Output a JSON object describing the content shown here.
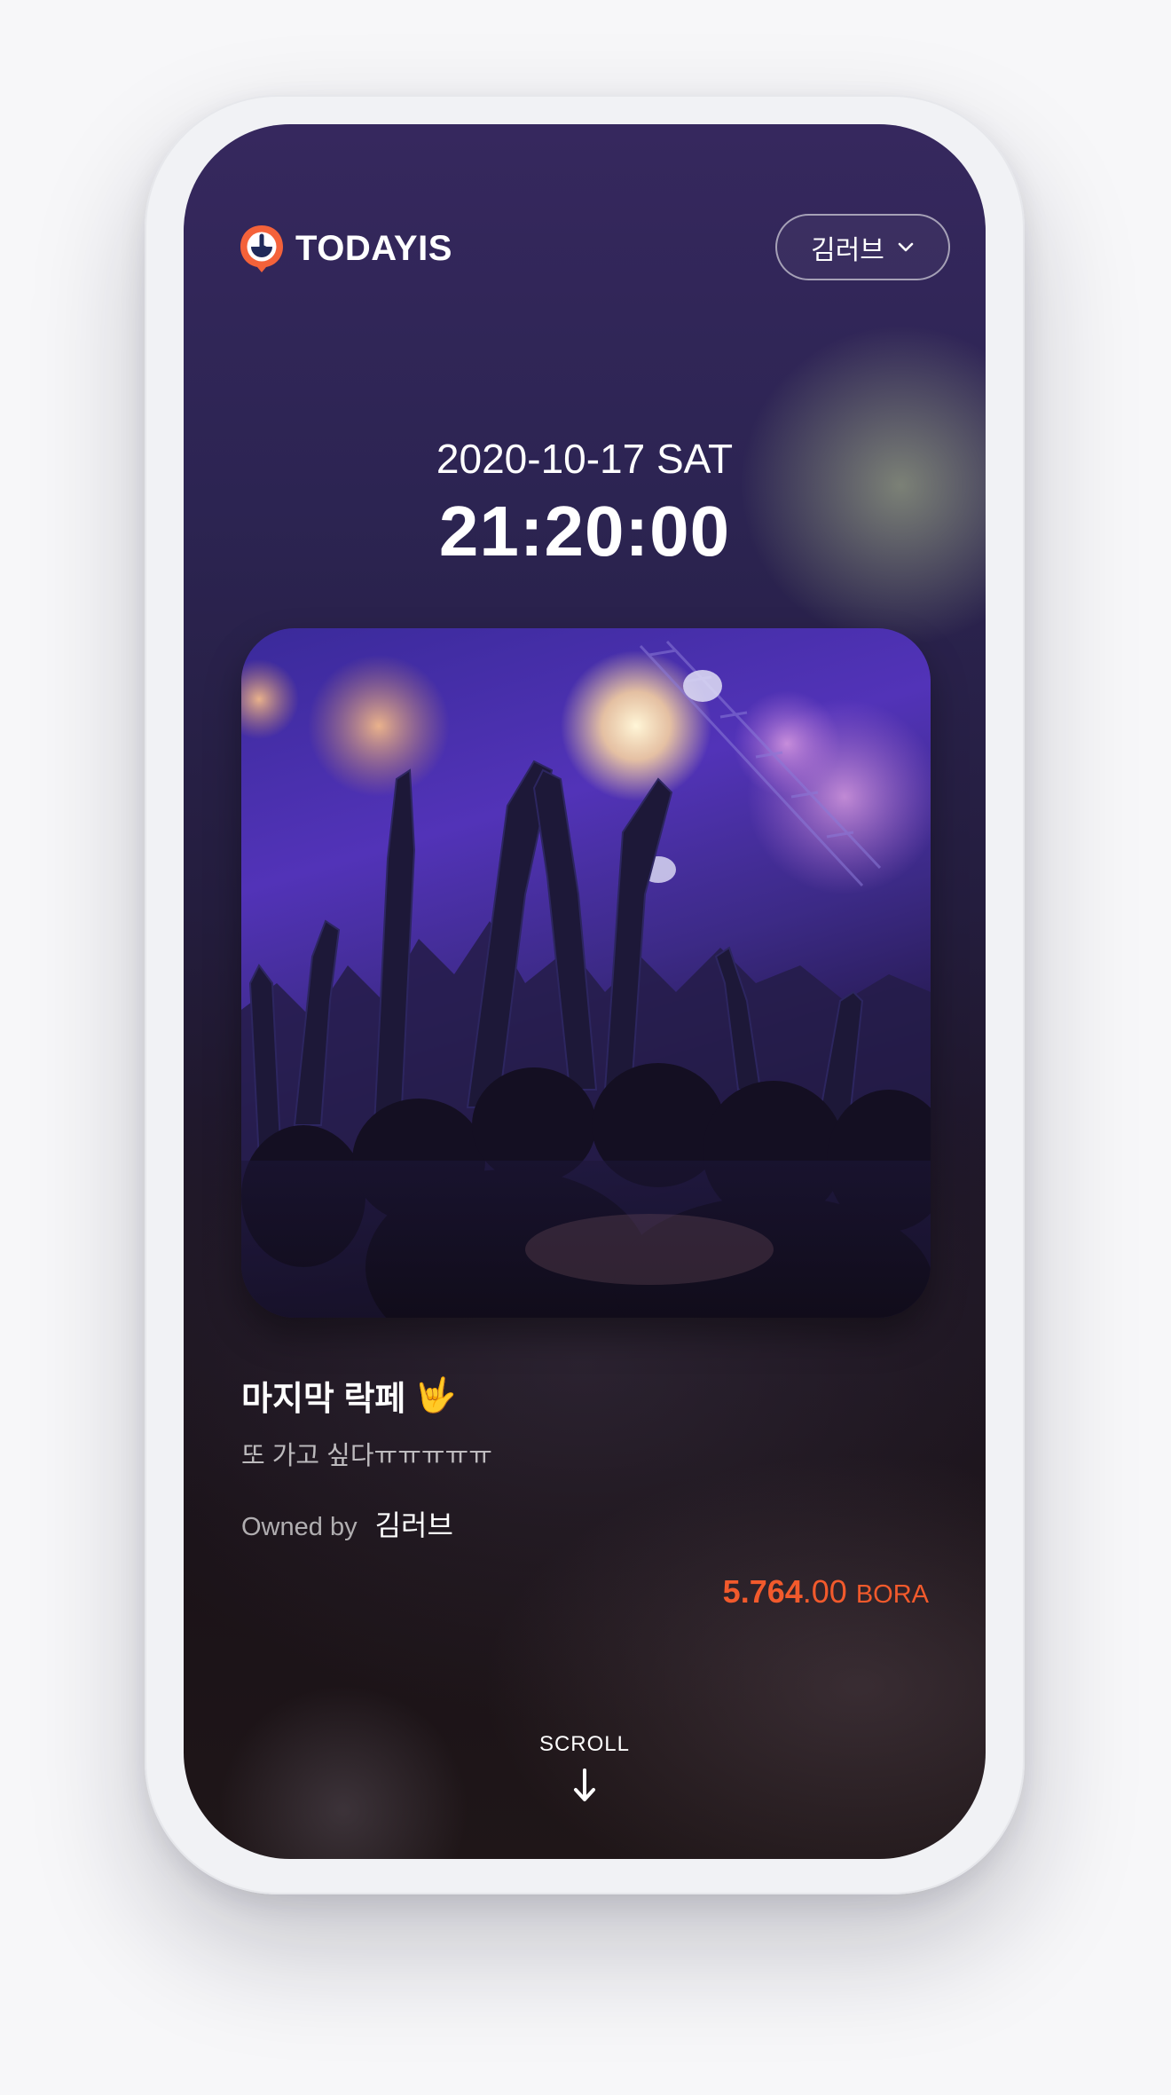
{
  "header": {
    "logo_text": "TODAYIS",
    "user_name": "김러브"
  },
  "moment": {
    "date": "2020-10-17 SAT",
    "time": "21:20:00"
  },
  "post": {
    "title": "마지막 락페",
    "title_emoji": "🤟",
    "subtitle": "또 가고 싶다ㅠㅠㅠㅠㅠ",
    "owned_by_label": "Owned by",
    "owner": "김러브"
  },
  "price": {
    "integer": "5.764",
    "decimal": ".00",
    "unit": "BORA"
  },
  "scroll": {
    "label": "SCROLL"
  },
  "icons": {
    "logo": "clock-speech-bubble-icon",
    "dropdown": "chevron-down-icon",
    "scroll": "arrow-down-icon"
  },
  "colors": {
    "accent": "#f25a2c",
    "logo_orange": "#f4623a",
    "logo_navy": "#1f2a5a"
  }
}
